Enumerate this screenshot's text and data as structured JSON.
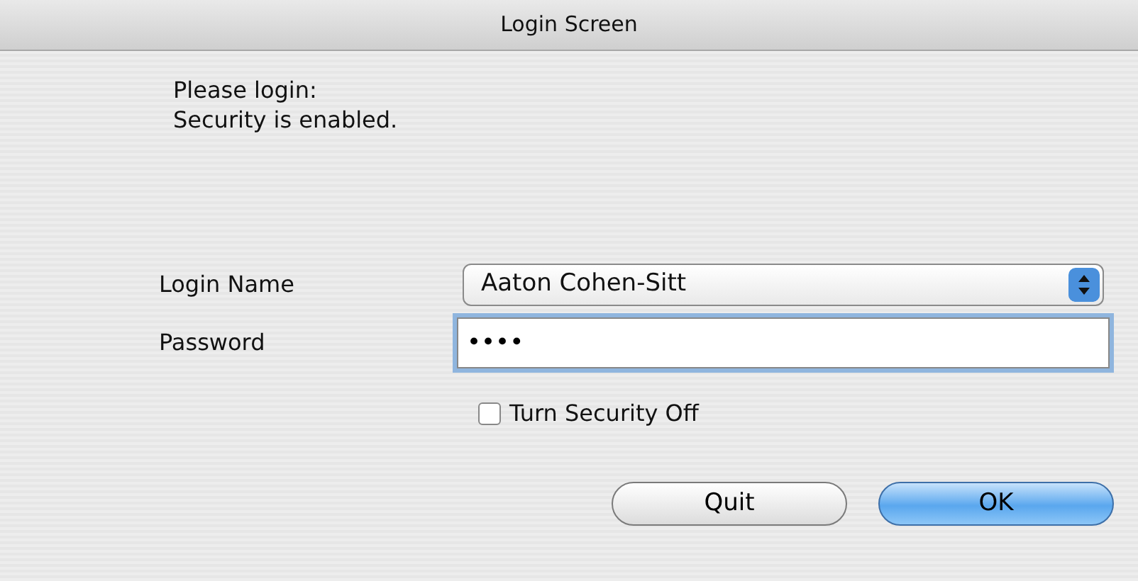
{
  "window": {
    "title": "Login Screen"
  },
  "message": [
    "Please login:",
    "Security is enabled."
  ],
  "login_name": {
    "label": "Login Name",
    "value": "Aaton Cohen-Sitt"
  },
  "password": {
    "label": "Password",
    "value": "••••",
    "focused": true
  },
  "security_off": {
    "label": "Turn Security Off",
    "checked": false
  },
  "buttons": [
    {
      "label": "Quit",
      "kind": "normal"
    },
    {
      "label": "OK",
      "kind": "default"
    }
  ]
}
